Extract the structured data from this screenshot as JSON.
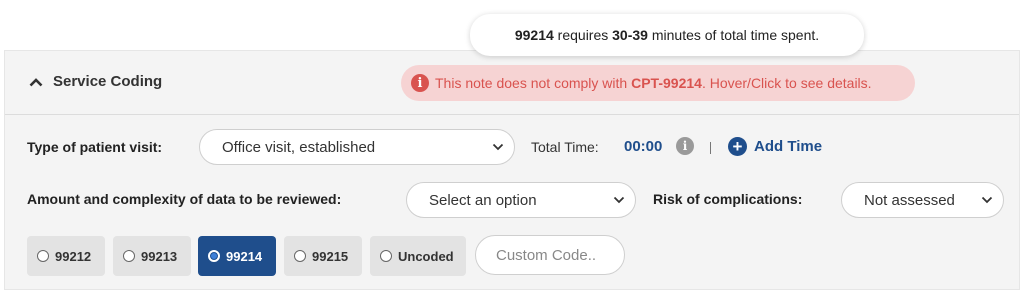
{
  "tooltip": {
    "code": "99214",
    "pre": " requires ",
    "range": "30-39",
    "post": " minutes of total time spent."
  },
  "section": {
    "title": "Service Coding"
  },
  "alert": {
    "icon": "i",
    "pre": "This note does not comply with ",
    "code": "CPT-99214",
    "post": ". Hover/Click to see details."
  },
  "visit": {
    "label": "Type of patient visit:",
    "value": "Office visit, established"
  },
  "time": {
    "label": "Total Time:",
    "value": "00:00",
    "info_icon": "i",
    "add_icon": "+",
    "add_label": "Add Time"
  },
  "data_review": {
    "label": "Amount and complexity of data to be reviewed:",
    "value": "Select an option"
  },
  "risk": {
    "label": "Risk of complications:",
    "value": "Not assessed"
  },
  "codes": [
    {
      "label": "99212",
      "selected": false
    },
    {
      "label": "99213",
      "selected": false
    },
    {
      "label": "99214",
      "selected": true
    },
    {
      "label": "99215",
      "selected": false
    },
    {
      "label": "Uncoded",
      "selected": false
    }
  ],
  "custom_code": {
    "placeholder": "Custom Code.."
  },
  "colors": {
    "accent": "#1f4e8c",
    "alert_text": "#d9534f",
    "alert_bg": "#f6d3d3"
  }
}
